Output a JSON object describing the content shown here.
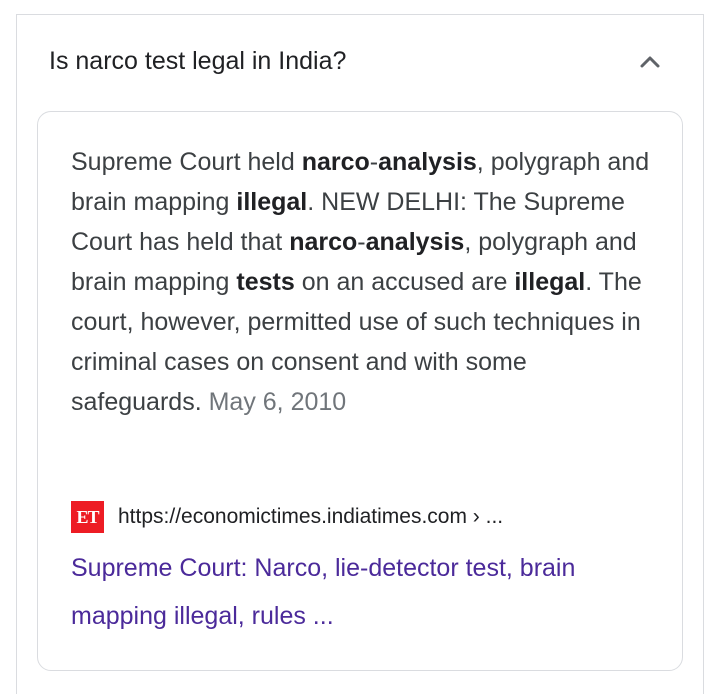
{
  "question": {
    "text": "Is narco test legal in India?"
  },
  "answer": {
    "snippet": [
      {
        "t": "Supreme Court held ",
        "b": false
      },
      {
        "t": "narco",
        "b": true
      },
      {
        "t": "-",
        "b": false
      },
      {
        "t": "analysis",
        "b": true
      },
      {
        "t": ", polygraph and brain mapping ",
        "b": false
      },
      {
        "t": "illegal",
        "b": true
      },
      {
        "t": ". NEW DELHI: The Supreme Court has held that ",
        "b": false
      },
      {
        "t": "narco",
        "b": true
      },
      {
        "t": "-",
        "b": false
      },
      {
        "t": "analysis",
        "b": true
      },
      {
        "t": ", polygraph and brain mapping ",
        "b": false
      },
      {
        "t": "tests",
        "b": true
      },
      {
        "t": " on an accused are ",
        "b": false
      },
      {
        "t": "illegal",
        "b": true
      },
      {
        "t": ". The court, however, permitted use of such techniques in criminal cases on consent and with some safeguards. ",
        "b": false
      }
    ],
    "date": "May 6, 2010"
  },
  "source": {
    "favicon_text": "ET",
    "url": "https://economictimes.indiatimes.com › ...",
    "title": "Supreme Court: Narco, lie-detector test, brain mapping illegal, rules ..."
  },
  "colors": {
    "link": "#4b2a9a",
    "favicon_bg": "#ed1c24",
    "border": "#dadce0"
  },
  "icons": {
    "toggle": "chevron-up-icon"
  }
}
